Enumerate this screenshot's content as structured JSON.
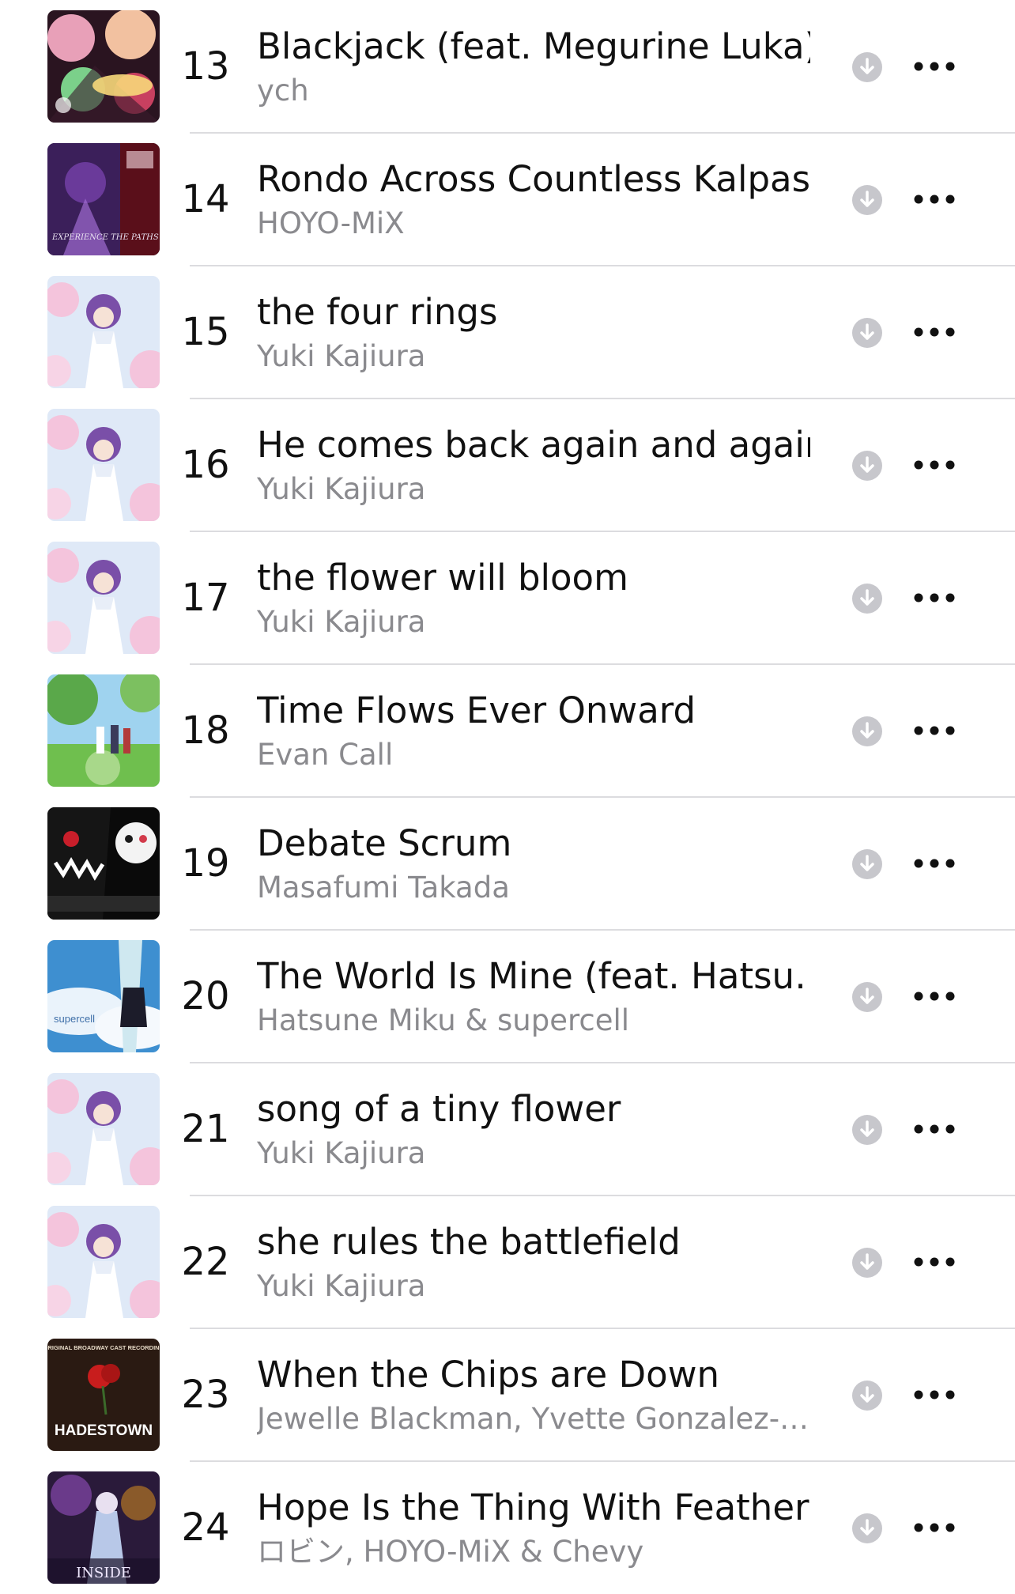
{
  "colors": {
    "separator": "#dcdcdf",
    "secondary_text": "#8a8a8e",
    "download_icon": "#c7c7cc",
    "more_icon": "#111111"
  },
  "tracks": [
    {
      "number": "13",
      "title": "Blackjack (feat. Megurine Luka)",
      "artist": "ych",
      "artwork": "casino-art",
      "download_icon": "download-circle-icon",
      "more_icon": "ellipsis-icon"
    },
    {
      "number": "14",
      "title": "Rondo Across Countless Kalpas",
      "artist": "HOYO-MiX",
      "artwork": "experience-the-paths-art",
      "artwork_text": "EXPERIENCE THE PATHS",
      "download_icon": "download-circle-icon",
      "more_icon": "ellipsis-icon"
    },
    {
      "number": "15",
      "title": "the four rings",
      "artist": "Yuki Kajiura",
      "artwork": "sakura-girl-art",
      "download_icon": "download-circle-icon",
      "more_icon": "ellipsis-icon"
    },
    {
      "number": "16",
      "title": "He comes back again and again",
      "artist": "Yuki Kajiura",
      "artwork": "sakura-girl-art",
      "download_icon": "download-circle-icon",
      "more_icon": "ellipsis-icon"
    },
    {
      "number": "17",
      "title": "the flower will bloom",
      "artist": "Yuki Kajiura",
      "artwork": "sakura-girl-art",
      "download_icon": "download-circle-icon",
      "more_icon": "ellipsis-icon"
    },
    {
      "number": "18",
      "title": "Time Flows Ever Onward",
      "artist": "Evan Call",
      "artwork": "meadow-art",
      "download_icon": "download-circle-icon",
      "more_icon": "ellipsis-icon"
    },
    {
      "number": "19",
      "title": "Debate Scrum",
      "artist": "Masafumi Takada",
      "artwork": "bear-art",
      "download_icon": "download-circle-icon",
      "more_icon": "ellipsis-icon"
    },
    {
      "number": "20",
      "title": "The World Is Mine (feat. Hatsu…",
      "artist": "Hatsune Miku & supercell",
      "artwork": "supercell-art",
      "artwork_text": "supercell",
      "download_icon": "download-circle-icon",
      "more_icon": "ellipsis-icon"
    },
    {
      "number": "21",
      "title": "song of a tiny flower",
      "artist": "Yuki Kajiura",
      "artwork": "sakura-girl-art",
      "download_icon": "download-circle-icon",
      "more_icon": "ellipsis-icon"
    },
    {
      "number": "22",
      "title": "she rules the battlefield",
      "artist": "Yuki Kajiura",
      "artwork": "sakura-girl-art",
      "download_icon": "download-circle-icon",
      "more_icon": "ellipsis-icon"
    },
    {
      "number": "23",
      "title": "When the Chips are Down",
      "artist": "Jewelle Blackman, Yvette Gonzalez-…",
      "artwork": "hadestown-art",
      "artwork_text": "HADESTOWN",
      "artwork_subtext": "ORIGINAL BROADWAY CAST RECORDING",
      "download_icon": "download-circle-icon",
      "more_icon": "ellipsis-icon"
    },
    {
      "number": "24",
      "title": "Hope Is the Thing With Feathers",
      "artist": "ロビン, HOYO-MiX & Chevy",
      "artwork": "inside-art",
      "artwork_text": "INSIDE",
      "download_icon": "download-circle-icon",
      "more_icon": "ellipsis-icon"
    }
  ]
}
